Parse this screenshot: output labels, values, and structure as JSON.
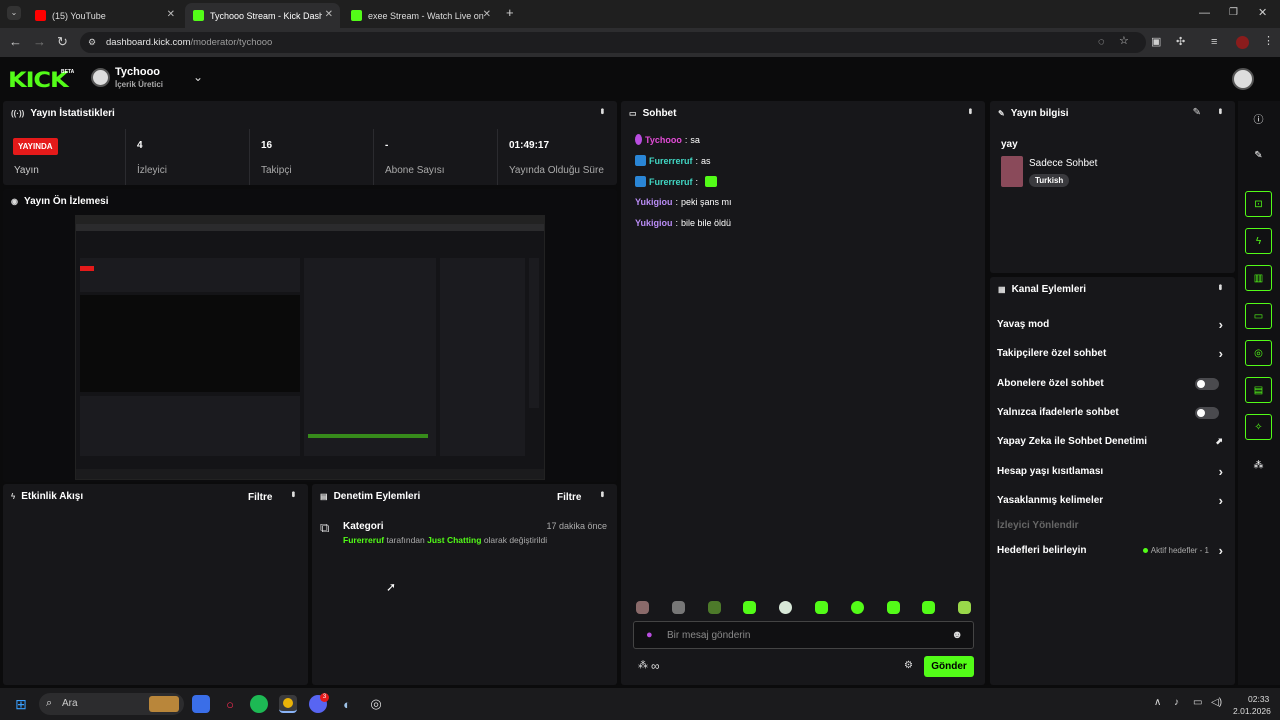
{
  "browser": {
    "tabs": [
      {
        "title": "(15) YouTube",
        "active": false
      },
      {
        "title": "Tychooo Stream - Kick Dashbo",
        "active": true
      },
      {
        "title": "exee Stream - Watch Live on Ki",
        "active": false
      }
    ],
    "url_host": "dashboard.kick.com",
    "url_path": "/moderator/tychooo"
  },
  "header": {
    "logo": "KICK",
    "beta": "BETA",
    "channel_name": "Tychooo",
    "channel_role": "İçerik Üretici"
  },
  "stats": {
    "title": "Yayın İstatistikleri",
    "live_badge": "YAYINDA",
    "items": [
      {
        "value": "",
        "label": "Yayın"
      },
      {
        "value": "4",
        "label": "İzleyici"
      },
      {
        "value": "16",
        "label": "Takipçi"
      },
      {
        "value": "-",
        "label": "Abone Sayısı"
      },
      {
        "value": "01:49:17",
        "label": "Yayında Olduğu Süre"
      }
    ]
  },
  "preview": {
    "title": "Yayın Ön İzlemesi"
  },
  "activity": {
    "title": "Etkinlik Akışı",
    "filter": "Filtre"
  },
  "moderation": {
    "title": "Denetim Eylemleri",
    "filter": "Filtre",
    "entry": {
      "heading": "Kategori",
      "time": "17 dakika önce",
      "user": "Furerreruf",
      "mid": "tarafından",
      "category": "Just Chatting",
      "tail": "olarak değiştirildi"
    }
  },
  "chat": {
    "title": "Sohbet",
    "messages": [
      {
        "user": "Tychooo",
        "text": "sa",
        "color": "#e24bd6"
      },
      {
        "user": "Furerreruf",
        "text": "as",
        "color": "#41d6c3"
      },
      {
        "user": "Furerreruf",
        "text": "",
        "color": "#41d6c3"
      },
      {
        "user": "Yukigiou",
        "text": "peki şans mı",
        "color": "#b98cf5"
      },
      {
        "user": "Yukigiou",
        "text": "bile bile öldü",
        "color": "#b98cf5"
      }
    ],
    "placeholder": "Bir mesaj gönderin",
    "send": "Gönder",
    "infinity": "∞"
  },
  "stream_info": {
    "title": "Yayın bilgisi",
    "stream_title": "yay",
    "category": "Sadece Sohbet",
    "tag": "Turkish"
  },
  "channel_actions": {
    "title": "Kanal Eylemleri",
    "items": [
      {
        "label": "Yavaş mod",
        "control": "chevron"
      },
      {
        "label": "Takipçilere özel sohbet",
        "control": "chevron"
      },
      {
        "label": "Abonelere özel sohbet",
        "control": "toggle"
      },
      {
        "label": "Yalnızca ifadelerle sohbet",
        "control": "toggle"
      },
      {
        "label": "Yapay Zeka ile Sohbet Denetimi",
        "control": "external"
      },
      {
        "label": "Hesap yaşı kısıtlaması",
        "control": "chevron"
      },
      {
        "label": "Yasaklanmış kelimeler",
        "control": "chevron"
      },
      {
        "label": "İzleyici Yönlendir",
        "control": "none"
      },
      {
        "label": "Hedefleri belirleyin",
        "control": "chevron"
      }
    ],
    "goals_status": "Aktif hedefler - 1"
  },
  "taskbar": {
    "search": "Ara",
    "time": "02:33",
    "date": "2.01.2026",
    "discord_badge": "3"
  },
  "colors": {
    "accent": "#53fc18",
    "live": "#e51a1a"
  }
}
